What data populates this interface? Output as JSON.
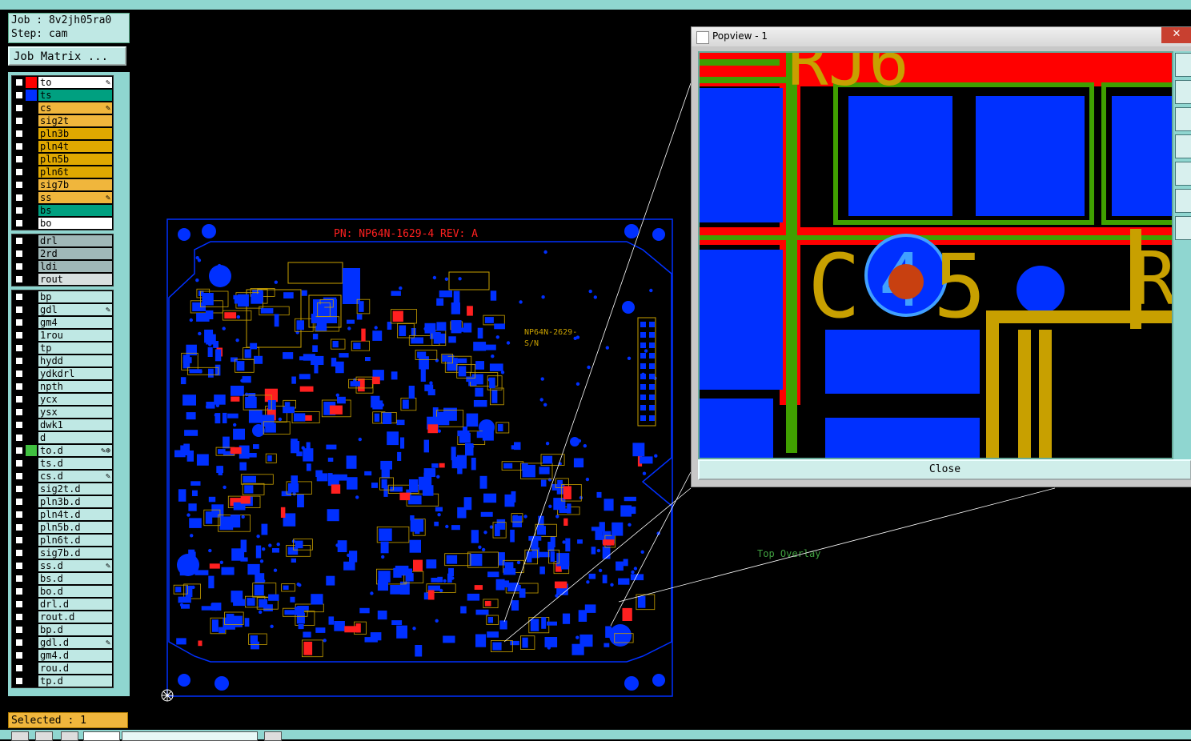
{
  "job": {
    "job_line": "Job : 8v2jh05ra0",
    "step_line": "Step: cam"
  },
  "buttons": {
    "job_matrix": "Job Matrix ..."
  },
  "layer_groups": [
    [
      {
        "name": "to",
        "swatch": "#ff0000",
        "bg": "#ffffff",
        "mark": "✎"
      },
      {
        "name": "ts",
        "swatch": "#0030ff",
        "bg": "#00a080",
        "mark": ""
      },
      {
        "name": "cs",
        "swatch": "#000000",
        "bg": "#f0b63c",
        "mark": "✎"
      },
      {
        "name": "sig2t",
        "swatch": "#000000",
        "bg": "#f0b63c",
        "mark": ""
      },
      {
        "name": "pln3b",
        "swatch": "#000000",
        "bg": "#e0a800",
        "mark": ""
      },
      {
        "name": "pln4t",
        "swatch": "#000000",
        "bg": "#e0a800",
        "mark": ""
      },
      {
        "name": "pln5b",
        "swatch": "#000000",
        "bg": "#e0a800",
        "mark": ""
      },
      {
        "name": "pln6t",
        "swatch": "#000000",
        "bg": "#e0a800",
        "mark": ""
      },
      {
        "name": "sig7b",
        "swatch": "#000000",
        "bg": "#f0b63c",
        "mark": ""
      },
      {
        "name": "ss",
        "swatch": "#000000",
        "bg": "#f0b63c",
        "mark": "✎"
      },
      {
        "name": "bs",
        "swatch": "#000000",
        "bg": "#00a080",
        "mark": ""
      },
      {
        "name": "bo",
        "swatch": "#000000",
        "bg": "#ffffff",
        "mark": ""
      }
    ],
    [
      {
        "name": "drl",
        "swatch": "#000000",
        "bg": "#a0b8b8",
        "mark": ""
      },
      {
        "name": "2rd",
        "swatch": "#000000",
        "bg": "#a0b8b8",
        "mark": ""
      },
      {
        "name": "ldi",
        "swatch": "#000000",
        "bg": "#a0b8b8",
        "mark": ""
      },
      {
        "name": "rout",
        "swatch": "#000000",
        "bg": "#d8e0e0",
        "mark": ""
      }
    ],
    [
      {
        "name": "bp",
        "swatch": "#000000",
        "bg": "#bfe8e4",
        "mark": ""
      },
      {
        "name": "gdl",
        "swatch": "#000000",
        "bg": "#bfe8e4",
        "mark": "✎"
      },
      {
        "name": "gm4",
        "swatch": "#000000",
        "bg": "#bfe8e4",
        "mark": ""
      },
      {
        "name": "1rou",
        "swatch": "#000000",
        "bg": "#bfe8e4",
        "mark": ""
      },
      {
        "name": "tp",
        "swatch": "#000000",
        "bg": "#bfe8e4",
        "mark": ""
      },
      {
        "name": "hydd",
        "swatch": "#000000",
        "bg": "#bfe8e4",
        "mark": ""
      },
      {
        "name": "ydkdrl",
        "swatch": "#000000",
        "bg": "#bfe8e4",
        "mark": ""
      },
      {
        "name": "npth",
        "swatch": "#000000",
        "bg": "#bfe8e4",
        "mark": ""
      },
      {
        "name": "ycx",
        "swatch": "#000000",
        "bg": "#bfe8e4",
        "mark": ""
      },
      {
        "name": "ysx",
        "swatch": "#000000",
        "bg": "#bfe8e4",
        "mark": ""
      },
      {
        "name": "dwk1",
        "swatch": "#000000",
        "bg": "#bfe8e4",
        "mark": ""
      },
      {
        "name": "d",
        "swatch": "#000000",
        "bg": "#bfe8e4",
        "mark": ""
      },
      {
        "name": "to.d",
        "swatch": "#40c040",
        "bg": "#bfe8e4",
        "mark": "✎⊕"
      },
      {
        "name": "ts.d",
        "swatch": "#000000",
        "bg": "#bfe8e4",
        "mark": ""
      },
      {
        "name": "cs.d",
        "swatch": "#000000",
        "bg": "#bfe8e4",
        "mark": "✎"
      },
      {
        "name": "sig2t.d",
        "swatch": "#000000",
        "bg": "#bfe8e4",
        "mark": ""
      },
      {
        "name": "pln3b.d",
        "swatch": "#000000",
        "bg": "#bfe8e4",
        "mark": ""
      },
      {
        "name": "pln4t.d",
        "swatch": "#000000",
        "bg": "#bfe8e4",
        "mark": ""
      },
      {
        "name": "pln5b.d",
        "swatch": "#000000",
        "bg": "#bfe8e4",
        "mark": ""
      },
      {
        "name": "pln6t.d",
        "swatch": "#000000",
        "bg": "#bfe8e4",
        "mark": ""
      },
      {
        "name": "sig7b.d",
        "swatch": "#000000",
        "bg": "#bfe8e4",
        "mark": ""
      },
      {
        "name": "ss.d",
        "swatch": "#000000",
        "bg": "#bfe8e4",
        "mark": "✎"
      },
      {
        "name": "bs.d",
        "swatch": "#000000",
        "bg": "#bfe8e4",
        "mark": ""
      },
      {
        "name": "bo.d",
        "swatch": "#000000",
        "bg": "#bfe8e4",
        "mark": ""
      },
      {
        "name": "drl.d",
        "swatch": "#000000",
        "bg": "#bfe8e4",
        "mark": ""
      },
      {
        "name": "rout.d",
        "swatch": "#000000",
        "bg": "#bfe8e4",
        "mark": ""
      },
      {
        "name": "bp.d",
        "swatch": "#000000",
        "bg": "#bfe8e4",
        "mark": ""
      },
      {
        "name": "gdl.d",
        "swatch": "#000000",
        "bg": "#bfe8e4",
        "mark": "✎"
      },
      {
        "name": "gm4.d",
        "swatch": "#000000",
        "bg": "#bfe8e4",
        "mark": ""
      },
      {
        "name": "rou.d",
        "swatch": "#000000",
        "bg": "#bfe8e4",
        "mark": ""
      },
      {
        "name": "tp.d",
        "swatch": "#000000",
        "bg": "#bfe8e4",
        "mark": ""
      }
    ]
  ],
  "status": {
    "selected": "Selected : 1"
  },
  "board": {
    "pn_text": "PN: NP64N-1629-4 REV: A",
    "sn_text_1": "NP64N-2629-",
    "sn_text_2": "S/N",
    "overlay_label": "Top Overlay"
  },
  "popview": {
    "title": "Popview - 1",
    "close_x": "✕",
    "close_button": "Close",
    "zoom_text_top": "RJ6",
    "zoom_text_c": "C",
    "zoom_text_4": "4",
    "zoom_text_5": "5",
    "zoom_text_r": "R"
  },
  "colors": {
    "teal_panel": "#8fd6d0",
    "board_outline": "#0030ff",
    "silk": "#c8a000",
    "pad": "#0030ff",
    "copper_red": "#ff0000",
    "green": "#40a000"
  }
}
